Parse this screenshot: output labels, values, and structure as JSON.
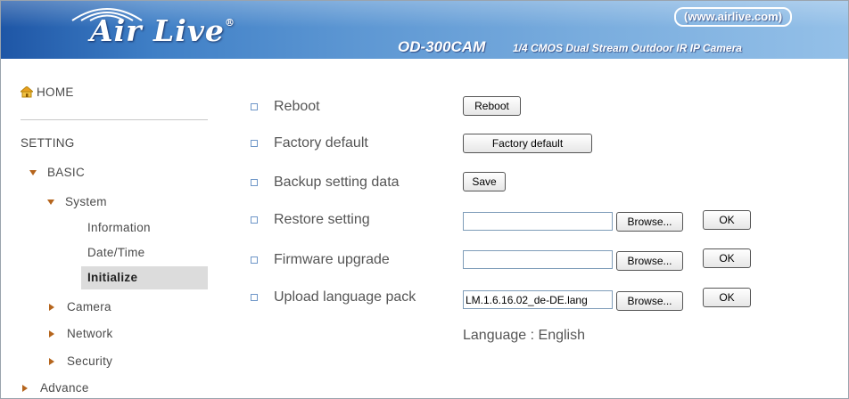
{
  "header": {
    "logo_text": "Air Live",
    "logo_mark": "®",
    "url": "(www.airlive.com)",
    "model": "OD-300CAM",
    "model_description": "1/4 CMOS Dual Stream Outdoor IR IP Camera"
  },
  "sidebar": {
    "home_label": "HOME",
    "home_icon": "home-icon",
    "setting_heading": "SETTING",
    "basic_label": "BASIC",
    "system_label": "System",
    "system_items": [
      "Information",
      "Date/Time",
      "Initialize"
    ],
    "selected_item": "Initialize",
    "camera_label": "Camera",
    "network_label": "Network",
    "security_label": "Security",
    "advance_label": "Advance",
    "accent_color": "#b5651d"
  },
  "main": {
    "reboot": {
      "label": "Reboot",
      "button": "Reboot"
    },
    "factory_default": {
      "label": "Factory default",
      "button": "Factory default"
    },
    "backup": {
      "label": "Backup setting data",
      "button": "Save"
    },
    "restore": {
      "label": "Restore setting",
      "value": "",
      "browse": "Browse...",
      "ok": "OK"
    },
    "firmware": {
      "label": "Firmware upgrade",
      "value": "",
      "browse": "Browse...",
      "ok": "OK"
    },
    "language_pack": {
      "label": "Upload language pack",
      "value": "LM.1.6.16.02_de-DE.lang",
      "browse": "Browse...",
      "ok": "OK"
    },
    "language_status": "Language : English"
  }
}
